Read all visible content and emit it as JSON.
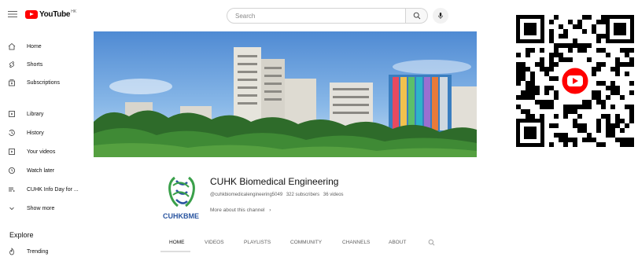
{
  "header": {
    "logo_text": "YouTube",
    "region": "HK",
    "search_placeholder": "Search"
  },
  "sidebar": {
    "items": [
      {
        "label": "Home",
        "icon": "home-icon"
      },
      {
        "label": "Shorts",
        "icon": "shorts-icon"
      },
      {
        "label": "Subscriptions",
        "icon": "subscriptions-icon"
      },
      {
        "label": "Library",
        "icon": "library-icon"
      },
      {
        "label": "History",
        "icon": "history-icon"
      },
      {
        "label": "Your videos",
        "icon": "your-videos-icon"
      },
      {
        "label": "Watch later",
        "icon": "watch-later-icon"
      },
      {
        "label": "CUHK Info Day for ...",
        "icon": "playlist-icon"
      },
      {
        "label": "Show more",
        "icon": "chevron-down-icon"
      }
    ],
    "explore_heading": "Explore",
    "explore_items": [
      {
        "label": "Trending",
        "icon": "trending-icon"
      }
    ]
  },
  "channel": {
    "name": "CUHK Biomedical Engineering",
    "handle": "@cuhkbiomedicalengineering5049",
    "subscribers": "322 subscribers",
    "videos": "36 videos",
    "more_about": "More about this channel",
    "avatar_text": "CUHKBME"
  },
  "tabs": [
    {
      "label": "HOME",
      "active": true
    },
    {
      "label": "VIDEOS",
      "active": false
    },
    {
      "label": "PLAYLISTS",
      "active": false
    },
    {
      "label": "COMMUNITY",
      "active": false
    },
    {
      "label": "CHANNELS",
      "active": false
    },
    {
      "label": "ABOUT",
      "active": false
    }
  ],
  "colors": {
    "brand_red": "#ff0000",
    "text_primary": "#0f0f0f",
    "text_secondary": "#606060",
    "avatar_green": "#3aa04a",
    "avatar_blue": "#2a55a0",
    "avatar_orange": "#f5a623"
  }
}
